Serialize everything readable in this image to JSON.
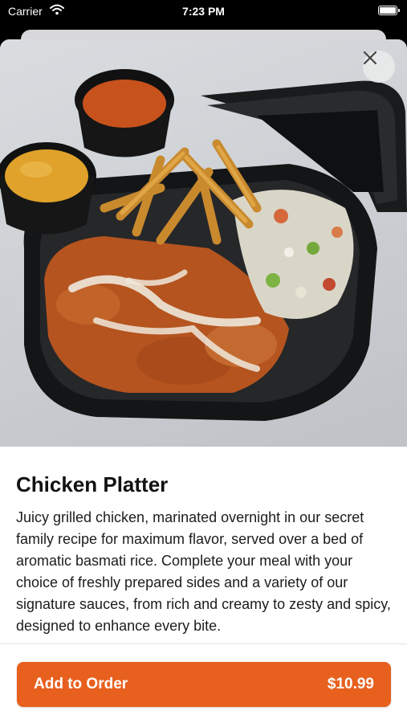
{
  "status_bar": {
    "carrier": "Carrier",
    "time": "7:23 PM",
    "battery_level": 1.0
  },
  "item": {
    "title": "Chicken Platter",
    "description": "Juicy grilled chicken, marinated overnight in our secret family recipe for maximum flavor, served over a bed of aromatic basmati rice. Complete your meal with your choice of freshly prepared sides and a variety of our signature sauces, from rich and creamy to zesty and spicy, designed to enhance every bite."
  },
  "footer": {
    "add_label": "Add to Order",
    "price": "$10.99"
  },
  "icons": {
    "close": "close-icon",
    "wifi": "wifi-icon",
    "battery": "battery-icon"
  },
  "colors": {
    "accent": "#e8601e",
    "text": "#111111"
  }
}
